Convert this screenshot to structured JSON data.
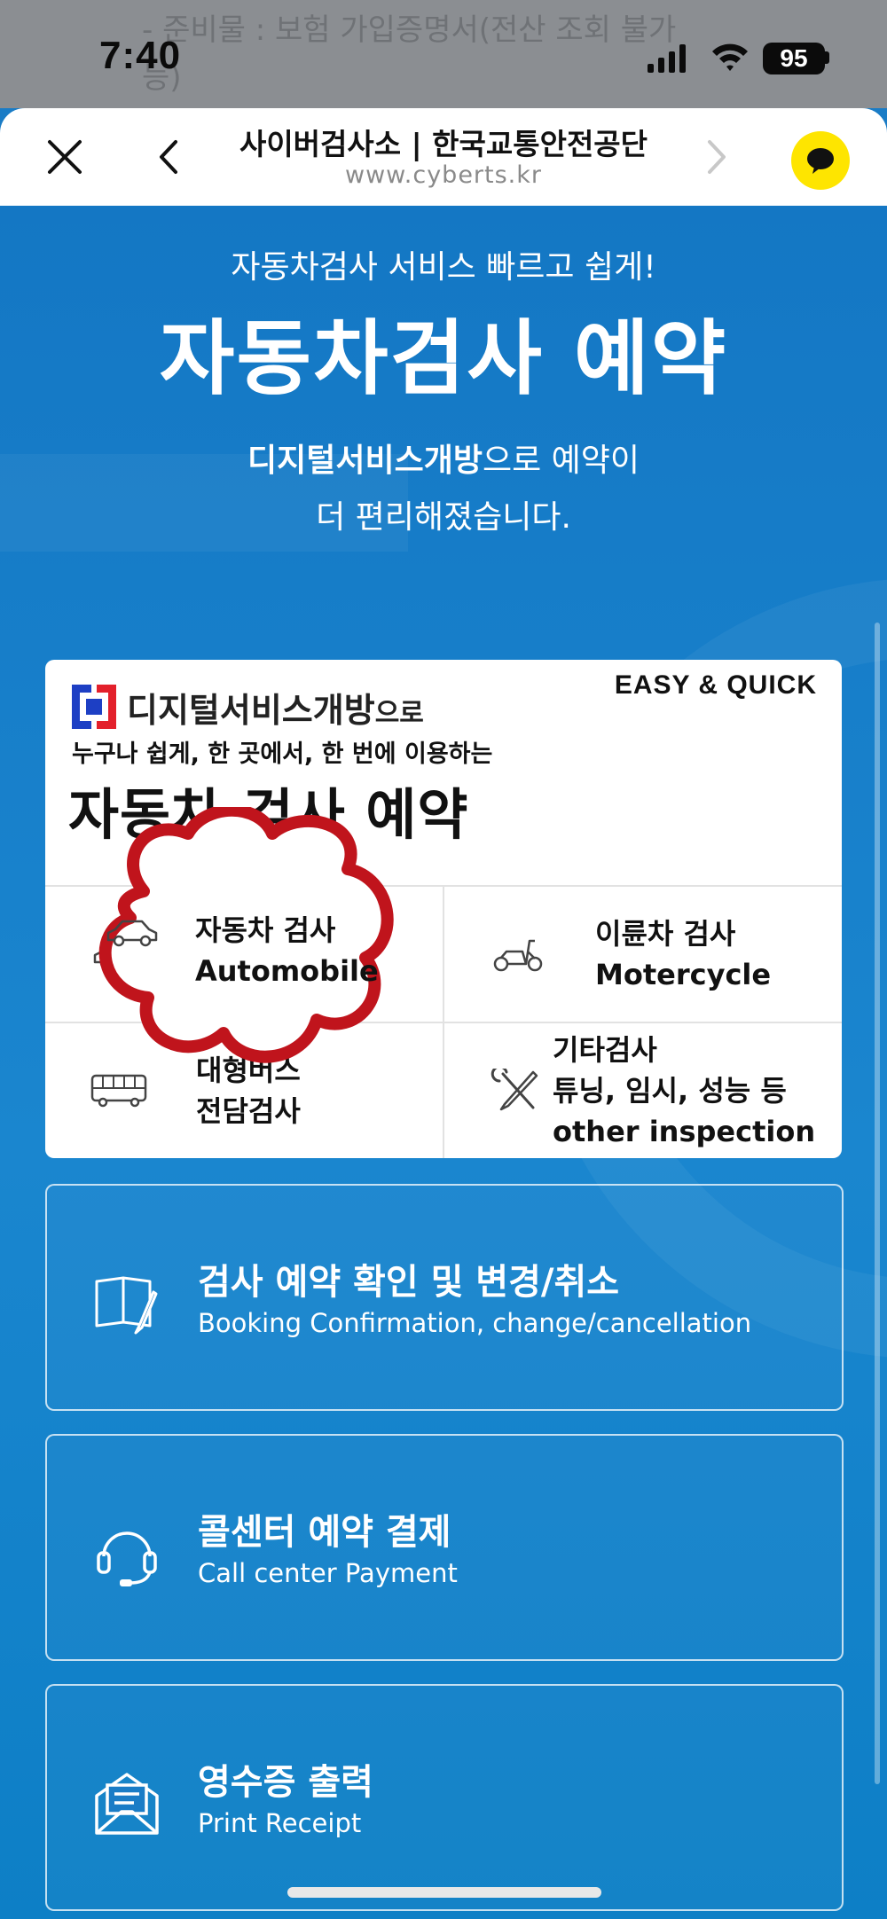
{
  "status": {
    "time": "7:40",
    "battery": "95",
    "bleed_text_1": "- 준비물 : 보험 가입증명서(전산 조회 불가",
    "bleed_text_2": "능)"
  },
  "browser": {
    "title": "사이버검사소 | 한국교통안전공단",
    "url": "www.cyberts.kr"
  },
  "hero": {
    "subtitle": "자동차검사 서비스 빠르고 쉽게!",
    "title": "자동차검사 예약",
    "desc_bold": "디지털서비스개방",
    "desc_rest": "으로 예약이",
    "desc_line2": "더 편리해졌습니다."
  },
  "card": {
    "logo_main": "디지털서비스개방",
    "logo_suffix": "으로",
    "badge": "EASY & QUICK",
    "subtitle": "누구나 쉽게, 한 곳에서, 한 번에 이용하는",
    "title": "자동차 검사 예약",
    "items": [
      {
        "line1": "자동차 검사",
        "line2": "Automobile",
        "icon": "car-icon"
      },
      {
        "line1": "이륜차 검사",
        "line2": "Motercycle",
        "icon": "scooter-icon"
      },
      {
        "line1": "대형버스",
        "line2": "전담검사",
        "icon": "bus-icon"
      },
      {
        "line1": "기타검사",
        "line2": "튜닝, 임시, 성능 등",
        "line3": "other inspection",
        "icon": "tools-icon"
      }
    ]
  },
  "menu": [
    {
      "title": "검사 예약 확인 및 변경/취소",
      "subtitle": "Booking Confirmation, change/cancellation",
      "icon": "book-pen-icon"
    },
    {
      "title": "콜센터 예약 결제",
      "subtitle": "Call center Payment",
      "icon": "headset-icon"
    },
    {
      "title": "영수증 출력",
      "subtitle": "Print Receipt",
      "icon": "receipt-icon"
    }
  ],
  "colors": {
    "hero_blue": "#1477c4",
    "kakao_yellow": "#fee500",
    "annotation_red": "#c0141c"
  }
}
